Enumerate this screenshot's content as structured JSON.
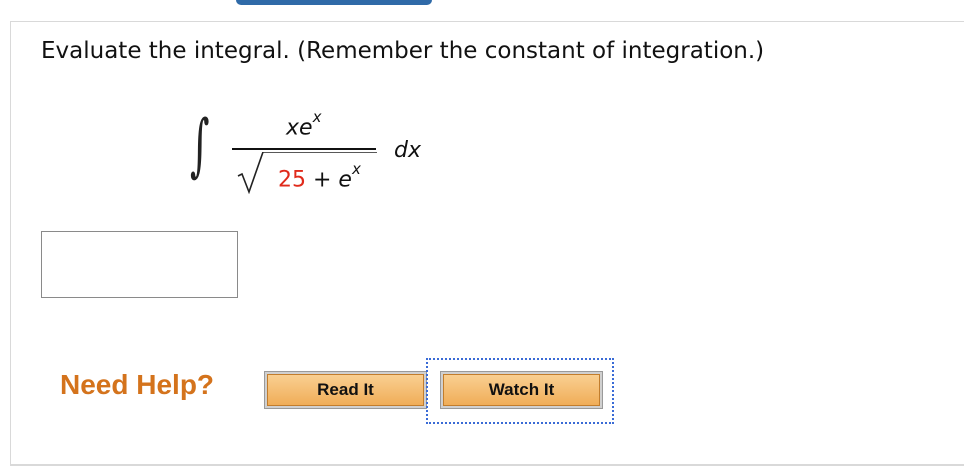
{
  "question": {
    "prompt": "Evaluate the integral. (Remember the constant of integration.)"
  },
  "integral": {
    "sign": "∫",
    "numerator_base": "xe",
    "numerator_exp": "x",
    "denominator_constant": "25",
    "denominator_op": " + ",
    "denominator_base": "e",
    "denominator_exp": "x",
    "differential": "dx"
  },
  "answer": {
    "value": ""
  },
  "help": {
    "label": "Need Help?",
    "read_label": "Read It",
    "watch_label": "Watch It"
  },
  "colors": {
    "accent_tab": "#2f6aa8",
    "help_text": "#d4731c",
    "highlight_number": "#e02a1b",
    "button_fill": "#f0ad58",
    "focus_ring": "#3a6bd6"
  }
}
